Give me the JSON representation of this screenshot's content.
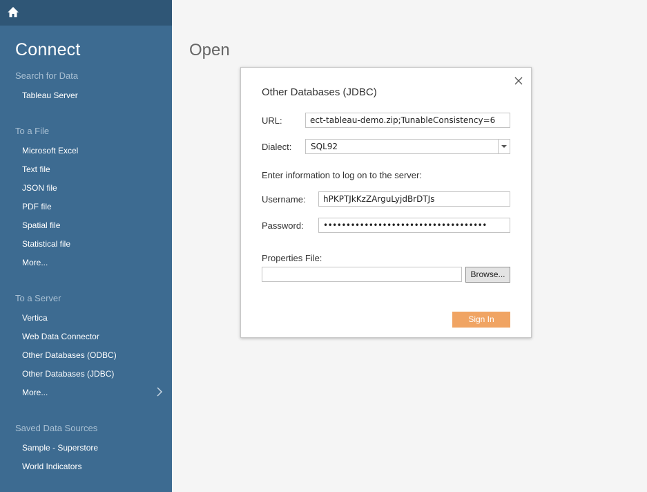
{
  "sidebar": {
    "title": "Connect",
    "search_header": "Search for Data",
    "search_items": [
      "Tableau Server"
    ],
    "file_header": "To a File",
    "file_items": [
      "Microsoft Excel",
      "Text file",
      "JSON file",
      "PDF file",
      "Spatial file",
      "Statistical file",
      "More..."
    ],
    "server_header": "To a Server",
    "server_items": [
      "Vertica",
      "Web Data Connector",
      "Other Databases (ODBC)",
      "Other Databases (JDBC)",
      "More..."
    ],
    "saved_header": "Saved Data Sources",
    "saved_items": [
      "Sample - Superstore",
      "World Indicators"
    ]
  },
  "main": {
    "title": "Open"
  },
  "dialog": {
    "title": "Other Databases (JDBC)",
    "url_label": "URL:",
    "url_value": "ect-tableau-demo.zip;TunableConsistency=6",
    "dialect_label": "Dialect:",
    "dialect_value": "SQL92",
    "info_text": "Enter information to log on to the server:",
    "username_label": "Username:",
    "username_value": "hPKPTJkKzZArguLyjdBrDTJs",
    "password_label": "Password:",
    "password_value": "••••••••••••••••••••••••••••••••••••",
    "properties_label": "Properties File:",
    "properties_value": "",
    "browse_label": "Browse...",
    "signin_label": "Sign In"
  },
  "colors": {
    "sidebar_bg": "#3d6b91",
    "sidebar_top": "#2f5676",
    "accent_orange": "#f0a463"
  }
}
